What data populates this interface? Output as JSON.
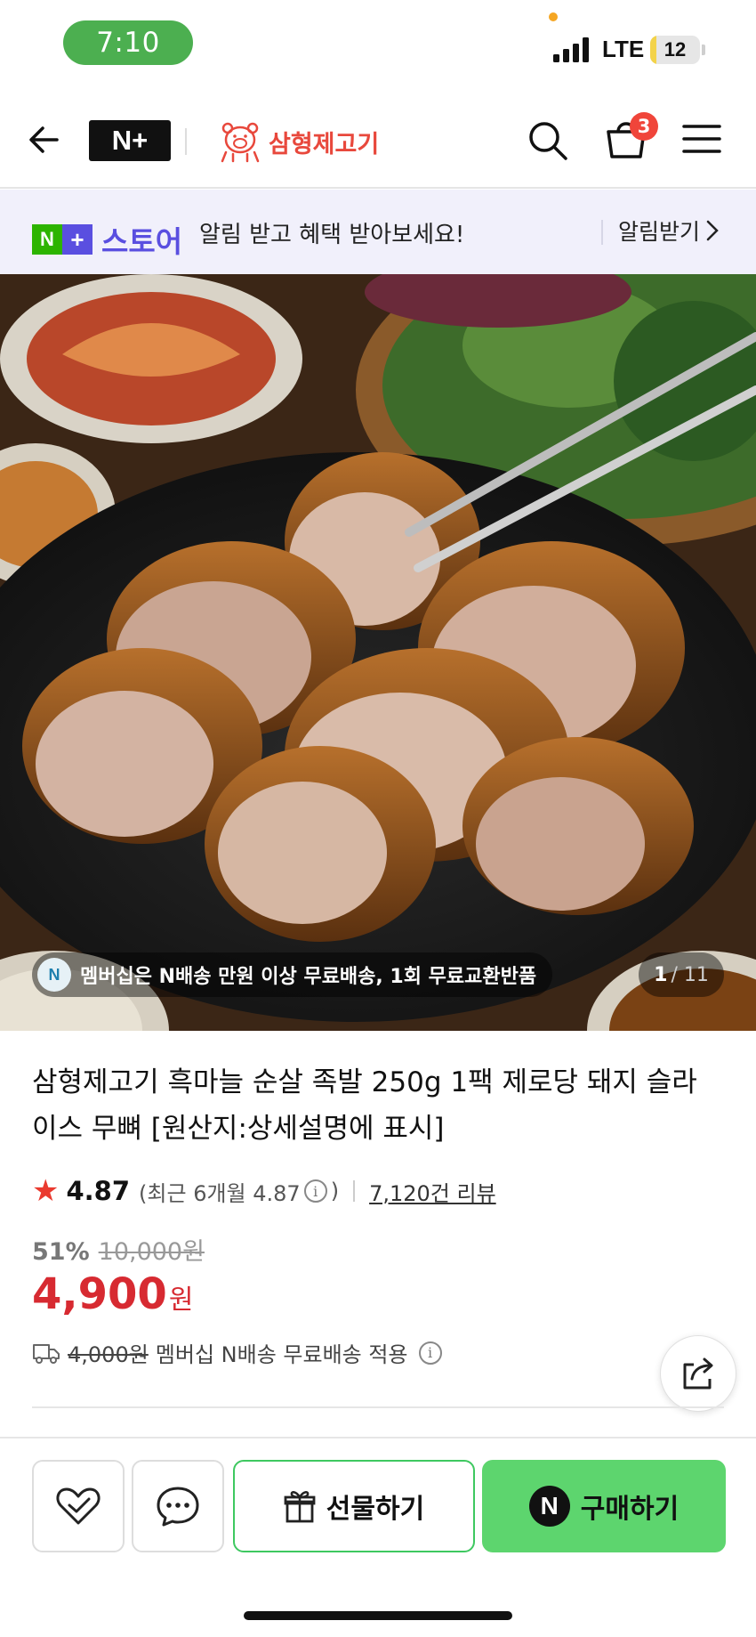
{
  "status_bar": {
    "time": "7:10",
    "network": "LTE",
    "battery_level": "12",
    "battery_fraction": 0.12
  },
  "header": {
    "nplus_logo": "N+",
    "brand_name": "삼형제고기",
    "cart_count": "3",
    "icons": [
      "back-arrow-icon",
      "search-icon",
      "cart-icon",
      "hamburger-menu-icon"
    ]
  },
  "notice": {
    "store_logo_text": "스토어",
    "message": "알림 받고 혜택 받아보세요!",
    "action_label": "알림받기",
    "accent_color": "#5a4fe0"
  },
  "hero": {
    "promo_text": "멤버십은 N배송 만원 이상 무료배송, 1회 무료교환반품",
    "page_current": "1",
    "page_total": "/ 11"
  },
  "product": {
    "title": "삼형제고기 흑마늘 순살 족발 250g 1팩 제로당 돼지 슬라이스 무뼈 [원산지:상세설명에 표시]",
    "rating": "4.87",
    "recent_rating_prefix": "(최근 6개월 4.87",
    "recent_rating_suffix": ")",
    "review_count": "7,120건 리뷰",
    "discount": "51%",
    "original_price": "10,000원",
    "price": "4,900",
    "currency": "원",
    "shipping_fee": "4,000원",
    "shipping_note": "멤버십 N배송 무료배송 적용",
    "price_color": "#d72a31"
  },
  "bottom_bar": {
    "gift_label": "선물하기",
    "buy_label": "구매하기",
    "buy_color": "#5dd56e"
  }
}
